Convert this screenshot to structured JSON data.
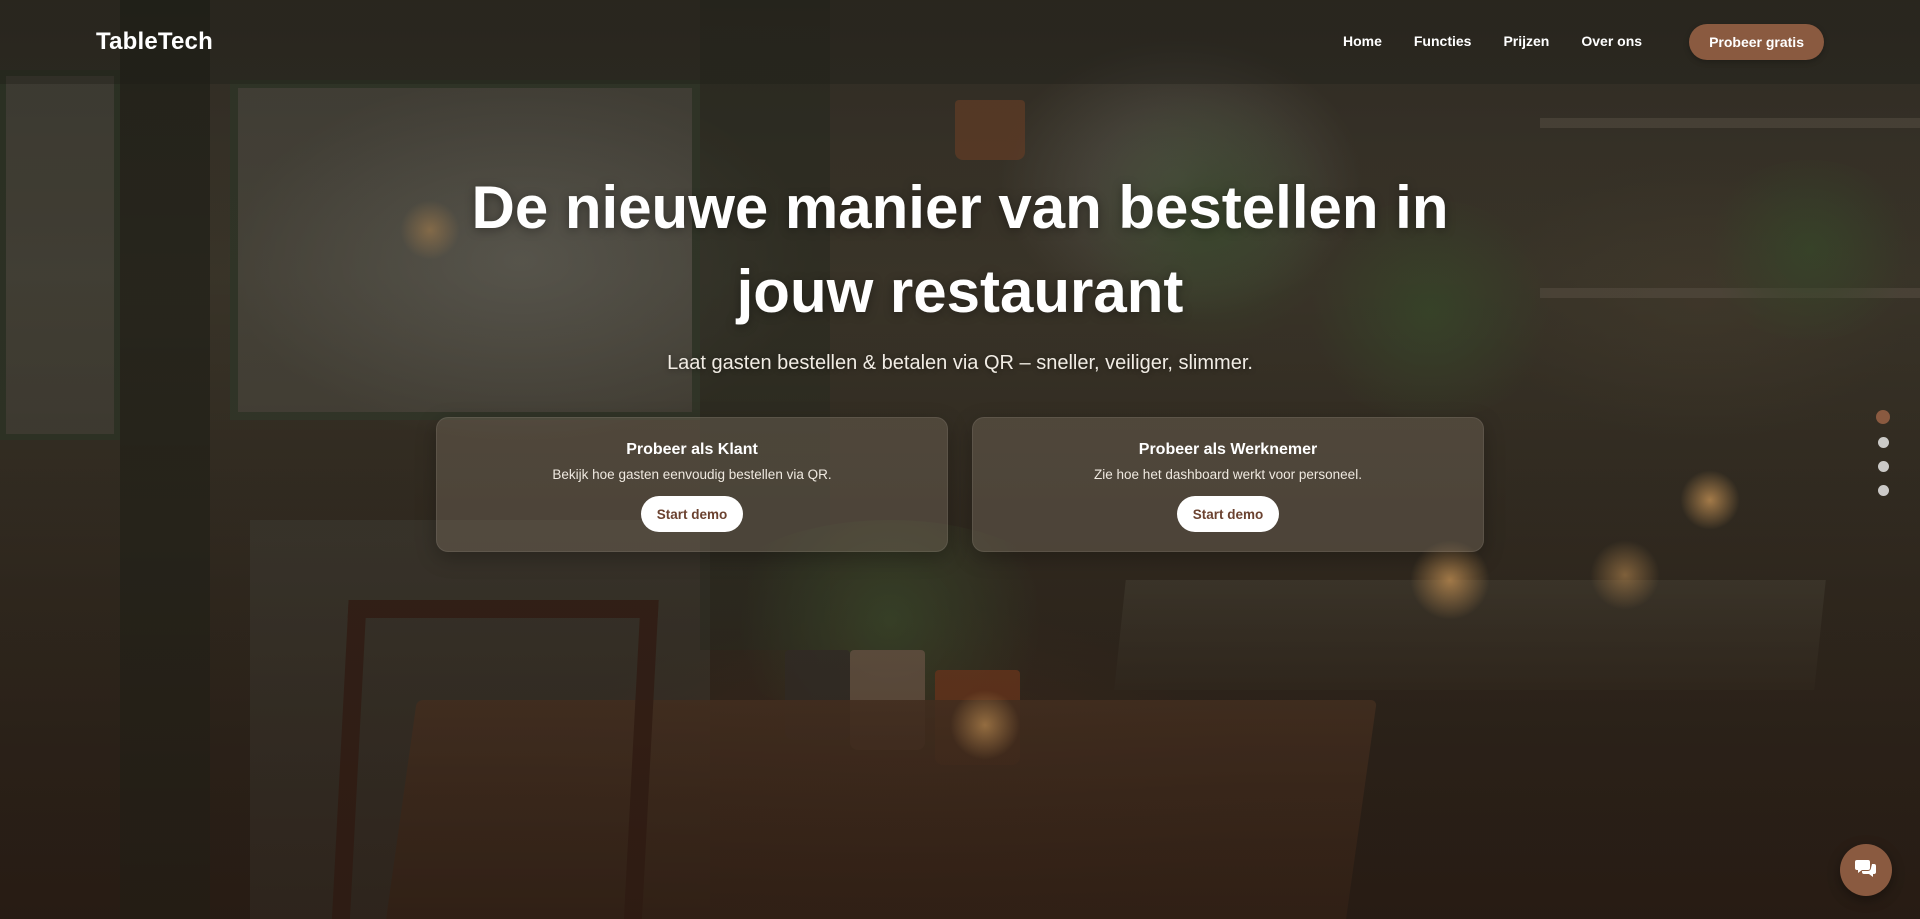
{
  "nav": {
    "brand": "TableTech",
    "links": [
      "Home",
      "Functies",
      "Prijzen",
      "Over ons"
    ],
    "cta": "Probeer gratis"
  },
  "hero": {
    "title": "De nieuwe manier van bestellen in jouw restaurant",
    "subtitle": "Laat gasten bestellen & betalen via QR – sneller, veiliger, slimmer."
  },
  "cards": [
    {
      "title": "Probeer als Klant",
      "text": "Bekijk hoe gasten eenvoudig bestellen via QR.",
      "button": "Start demo"
    },
    {
      "title": "Probeer als Werknemer",
      "text": "Zie hoe het dashboard werkt voor personeel.",
      "button": "Start demo"
    }
  ],
  "slider": {
    "count": 4,
    "active_index": 0
  },
  "colors": {
    "accent": "#8a5a40",
    "button_text": "#6b4230",
    "text": "#ffffff"
  },
  "icons": {
    "chat": "chat-bubbles-icon"
  }
}
